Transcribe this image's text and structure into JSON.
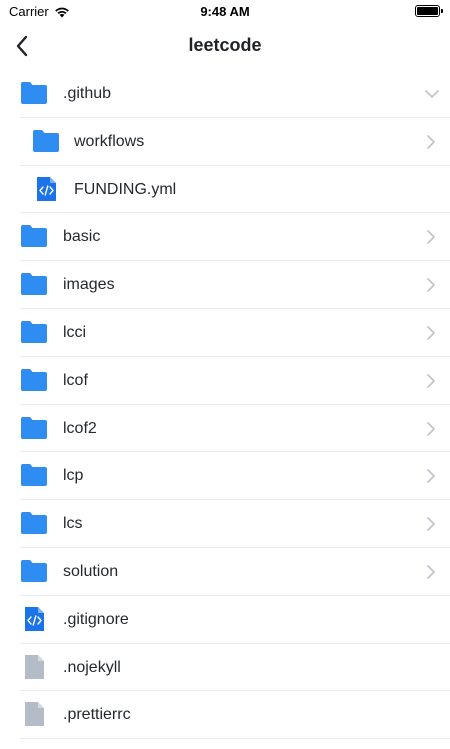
{
  "status": {
    "carrier": "Carrier",
    "time": "9:48 AM"
  },
  "nav": {
    "title": "leetcode"
  },
  "colors": {
    "folder": "#2f8cf0",
    "code_file": "#1a73e8",
    "plain_file": "#b4bcc8",
    "chevron": "#c2c6cc"
  },
  "items": [
    {
      "name": ".github",
      "type": "folder",
      "indent": false,
      "chevron": "down"
    },
    {
      "name": "workflows",
      "type": "folder",
      "indent": true,
      "chevron": "right"
    },
    {
      "name": "FUNDING.yml",
      "type": "code",
      "indent": true,
      "chevron": "none"
    },
    {
      "name": "basic",
      "type": "folder",
      "indent": false,
      "chevron": "right"
    },
    {
      "name": "images",
      "type": "folder",
      "indent": false,
      "chevron": "right"
    },
    {
      "name": "lcci",
      "type": "folder",
      "indent": false,
      "chevron": "right"
    },
    {
      "name": "lcof",
      "type": "folder",
      "indent": false,
      "chevron": "right"
    },
    {
      "name": "lcof2",
      "type": "folder",
      "indent": false,
      "chevron": "right"
    },
    {
      "name": "lcp",
      "type": "folder",
      "indent": false,
      "chevron": "right"
    },
    {
      "name": "lcs",
      "type": "folder",
      "indent": false,
      "chevron": "right"
    },
    {
      "name": "solution",
      "type": "folder",
      "indent": false,
      "chevron": "right"
    },
    {
      "name": ".gitignore",
      "type": "code",
      "indent": false,
      "chevron": "none"
    },
    {
      "name": ".nojekyll",
      "type": "file",
      "indent": false,
      "chevron": "none"
    },
    {
      "name": ".prettierrc",
      "type": "file",
      "indent": false,
      "chevron": "none"
    }
  ]
}
